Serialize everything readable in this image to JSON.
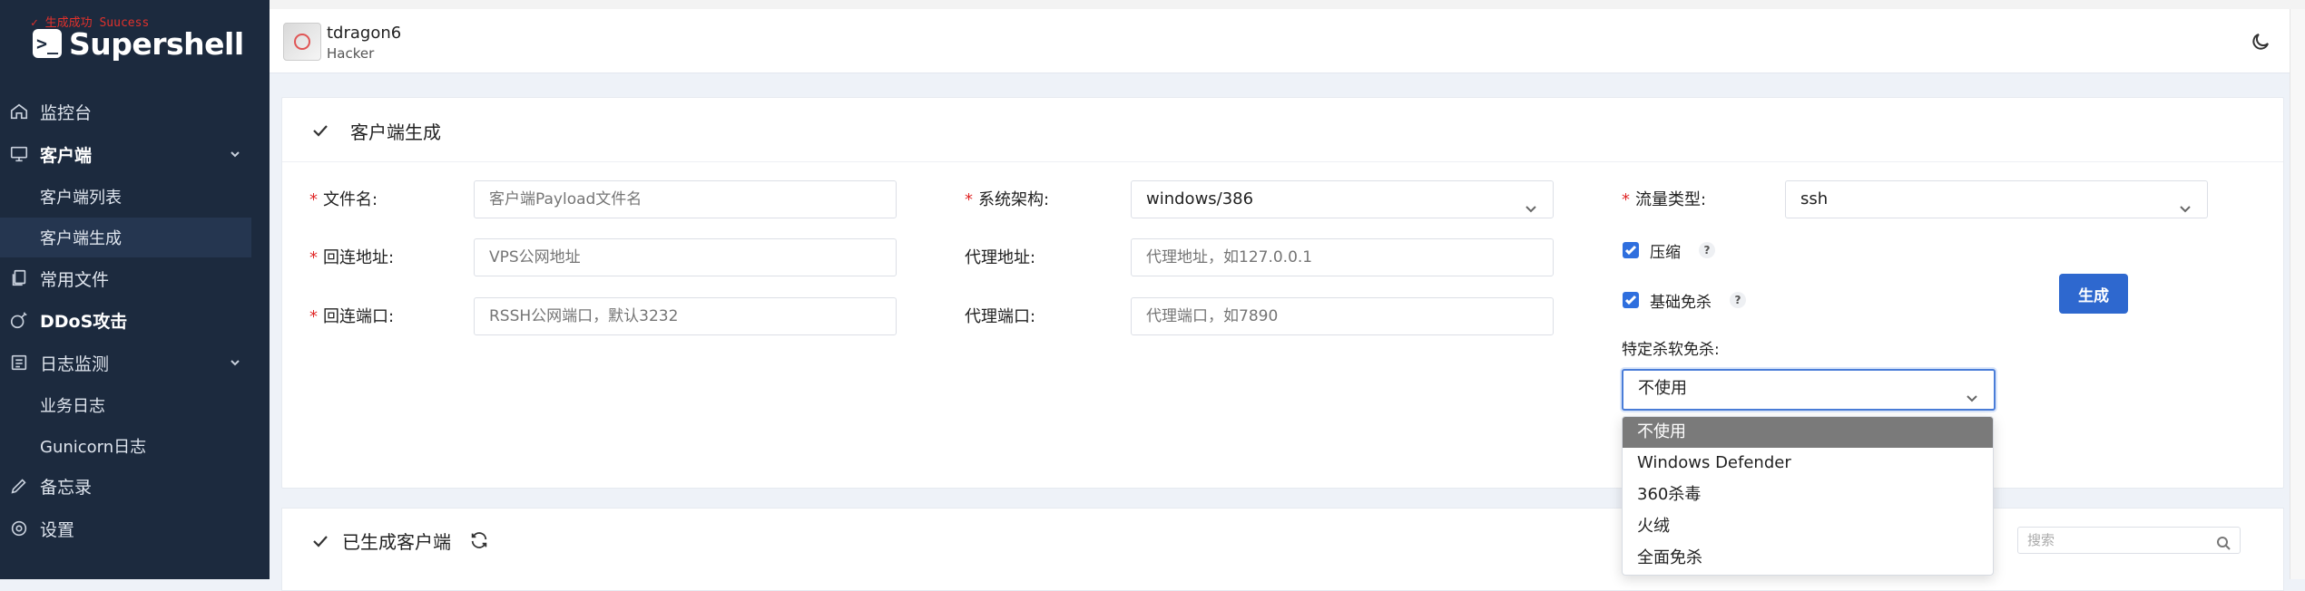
{
  "brand": {
    "name": "Supershell",
    "badge": "✓ 生成成功 Suucess"
  },
  "sidebar": {
    "items": [
      {
        "label": "监控台",
        "icon": "home-icon"
      },
      {
        "label": "客户端",
        "icon": "monitor-icon"
      },
      {
        "label": "客户端列表"
      },
      {
        "label": "客户端生成"
      },
      {
        "label": "常用文件",
        "icon": "files-icon"
      },
      {
        "label": "DDoS攻击",
        "icon": "bomb-icon"
      },
      {
        "label": "日志监测",
        "icon": "log-icon"
      },
      {
        "label": "业务日志"
      },
      {
        "label": "Gunicorn日志"
      },
      {
        "label": "备忘录",
        "icon": "pencil-icon"
      },
      {
        "label": "设置",
        "icon": "gear-icon"
      }
    ]
  },
  "header": {
    "username": "tdragon6",
    "role": "Hacker"
  },
  "form": {
    "title": "客户端生成",
    "filename": {
      "label": "文件名:",
      "placeholder": "客户端Payload文件名"
    },
    "back_addr": {
      "label": "回连地址:",
      "placeholder": "VPS公网地址"
    },
    "back_port": {
      "label": "回连端口:",
      "placeholder": "RSSH公网端口，默认3232"
    },
    "arch": {
      "label": "系统架构:",
      "value": "windows/386"
    },
    "proxy_addr": {
      "label": "代理地址:",
      "placeholder": "代理地址，如127.0.0.1"
    },
    "proxy_port": {
      "label": "代理端口:",
      "placeholder": "代理端口，如7890"
    },
    "traffic": {
      "label": "流量类型:",
      "value": "ssh"
    },
    "compress": {
      "label": "压缩",
      "help": "?"
    },
    "basic_av": {
      "label": "基础免杀",
      "help": "?"
    },
    "specific_av": {
      "label": "特定杀软免杀:",
      "value": "不使用"
    },
    "generate_label": "生成"
  },
  "dropdown": {
    "options": [
      "不使用",
      "Windows Defender",
      "360杀毒",
      "火绒",
      "全面免杀"
    ],
    "selected_index": 0
  },
  "generated": {
    "title": "已生成客户端",
    "search_placeholder": "搜索"
  },
  "colors": {
    "sidebar_bg": "#1c2a3e",
    "primary": "#2e68cf",
    "required": "#e02828"
  }
}
